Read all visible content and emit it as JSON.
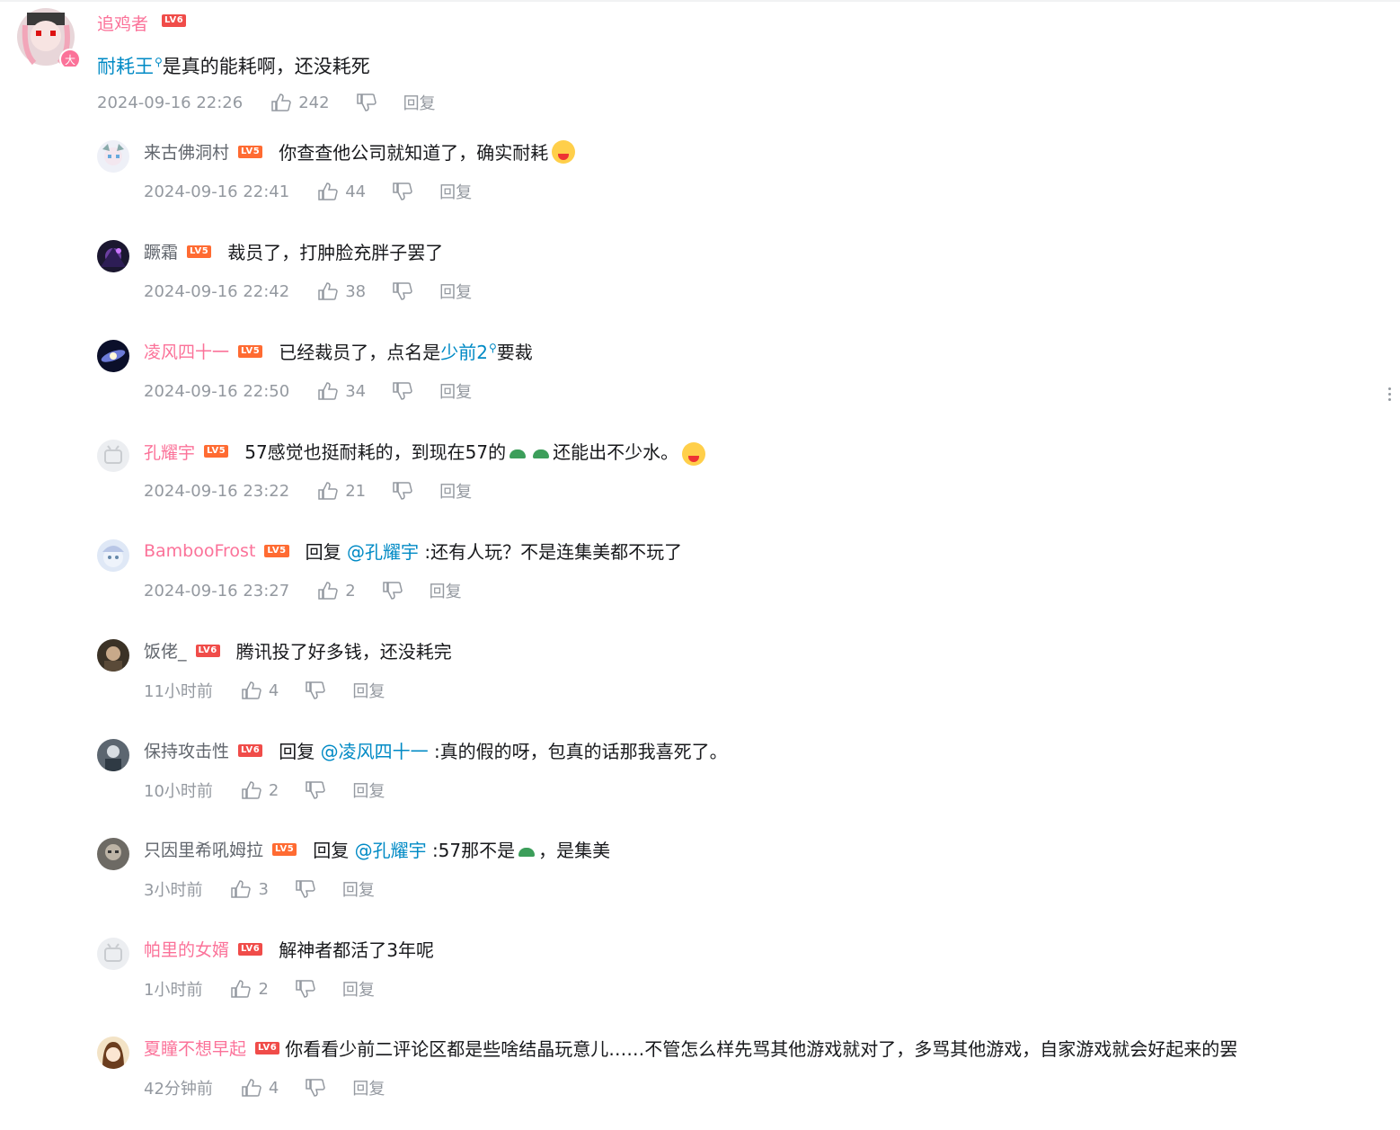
{
  "root": {
    "username": "追鸡者",
    "level": "LV6",
    "content_link": "耐耗王",
    "content_text": "是真的能耗啊，还没耗死",
    "time": "2024-09-16 22:26",
    "likes": "242",
    "reply_label": "回复"
  },
  "replies": [
    {
      "username": "来古佛洞村",
      "level": "LV5",
      "prefix": "",
      "mention": "",
      "text": "你查查他公司就知道了，确实耐耗",
      "time": "2024-09-16 22:41",
      "likes": "44",
      "reply_label": "回复"
    },
    {
      "username": "蹶霜",
      "level": "LV5",
      "prefix": "",
      "mention": "",
      "text": "裁员了，打肿脸充胖子罢了",
      "time": "2024-09-16 22:42",
      "likes": "38",
      "reply_label": "回复"
    },
    {
      "username": "凌风四十一",
      "level": "LV5",
      "prefix": "",
      "mention": "",
      "text_a": "已经裁员了，点名是",
      "link": "少前2",
      "text_b": "要裁",
      "time": "2024-09-16 22:50",
      "likes": "34",
      "reply_label": "回复"
    },
    {
      "username": "孔耀宇",
      "level": "LV5",
      "prefix": "",
      "mention": "",
      "text_a": "57感觉也挺耐耗的，到现在57的",
      "text_b": "还能出不少水。",
      "time": "2024-09-16 23:22",
      "likes": "21",
      "reply_label": "回复"
    },
    {
      "username": "BambooFrost",
      "level": "LV5",
      "prefix": "回复",
      "mention": "@孔耀宇",
      "text": ":还有人玩？不是连集美都不玩了",
      "time": "2024-09-16 23:27",
      "likes": "2",
      "reply_label": "回复"
    },
    {
      "username": "饭佬_",
      "level": "LV6",
      "prefix": "",
      "mention": "",
      "text": "腾讯投了好多钱，还没耗完",
      "time": "11小时前",
      "likes": "4",
      "reply_label": "回复"
    },
    {
      "username": "保持攻击性",
      "level": "LV6",
      "prefix": "回复",
      "mention": "@凌风四十一",
      "text": ":真的假的呀，包真的话那我喜死了。",
      "time": "10小时前",
      "likes": "2",
      "reply_label": "回复"
    },
    {
      "username": "只因里希吼姆拉",
      "level": "LV5",
      "prefix": "回复",
      "mention": "@孔耀宇",
      "text_a": ":57那不是",
      "text_b": "，是集美",
      "time": "3小时前",
      "likes": "3",
      "reply_label": "回复"
    },
    {
      "username": "帕里的女婿",
      "level": "LV6",
      "prefix": "",
      "mention": "",
      "text": "解神者都活了3年呢",
      "time": "1小时前",
      "likes": "2",
      "reply_label": "回复"
    },
    {
      "username": "夏瞳不想早起",
      "level": "LV6",
      "prefix": "",
      "mention": "",
      "text": "你看看少前二评论区都是些啥结晶玩意儿……不管怎么样先骂其他游戏就对了，多骂其他游戏，自家游戏就会好起来的罢",
      "time": "42分钟前",
      "likes": "4",
      "reply_label": "回复"
    }
  ],
  "colors": {
    "vip_pink": "#fb7299",
    "link_blue": "#008ac5",
    "meta_gray": "#9499a0"
  }
}
